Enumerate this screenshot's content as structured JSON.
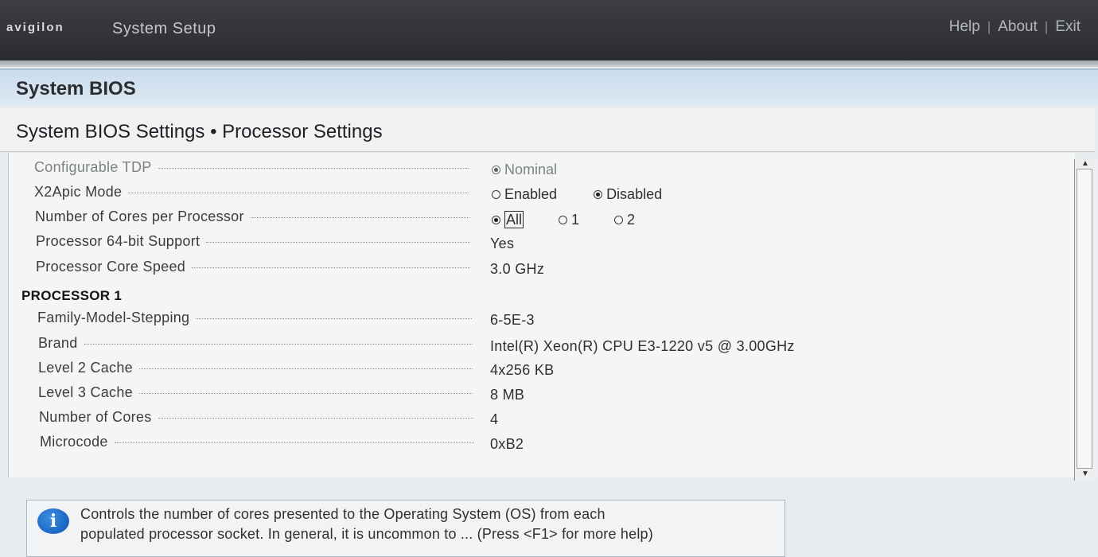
{
  "header": {
    "logo": "avigilon",
    "app_title": "System Setup",
    "links": [
      "Help",
      "About",
      "Exit"
    ],
    "separator": "|"
  },
  "page": {
    "title": "System BIOS",
    "section_title": "System BIOS Settings • Processor Settings"
  },
  "settings": {
    "configurable_tdp": {
      "label": "Configurable TDP",
      "option": "Nominal"
    },
    "x2apic": {
      "label": "X2Apic Mode",
      "opt_enabled": "Enabled",
      "opt_disabled": "Disabled",
      "selected": "Disabled"
    },
    "cores_per_processor": {
      "label": "Number of Cores per Processor",
      "opt_all": "All",
      "opt_1": "1",
      "opt_2": "2",
      "selected": "All"
    },
    "processor_64bit": {
      "label": "Processor 64-bit Support",
      "value": "Yes"
    },
    "core_speed": {
      "label": "Processor Core Speed",
      "value": "3.0 GHz"
    }
  },
  "processor1": {
    "header": "PROCESSOR 1",
    "family_model_stepping": {
      "label": "Family-Model-Stepping",
      "value": "6-5E-3"
    },
    "brand": {
      "label": "Brand",
      "value": "Intel(R) Xeon(R) CPU E3-1220 v5 @ 3.00GHz"
    },
    "l2_cache": {
      "label": "Level 2 Cache",
      "value": "4x256 KB"
    },
    "l3_cache": {
      "label": "Level 3 Cache",
      "value": "8 MB"
    },
    "num_cores": {
      "label": "Number of Cores",
      "value": "4"
    },
    "microcode": {
      "label": "Microcode",
      "value": "0xB2"
    }
  },
  "help": {
    "line1": "Controls the number of cores presented to the Operating System (OS) from each",
    "line2": "populated processor socket. In general, it is uncommon to ... (Press <F1> for more help)"
  },
  "icons": {
    "info": "info-icon",
    "scroll_up": "scroll-up-icon",
    "scroll_down": "scroll-down-icon"
  },
  "colors": {
    "header_bg": "#2f3135",
    "page_head_bg": "#d3e2ee",
    "info_icon": "#1565c0"
  }
}
